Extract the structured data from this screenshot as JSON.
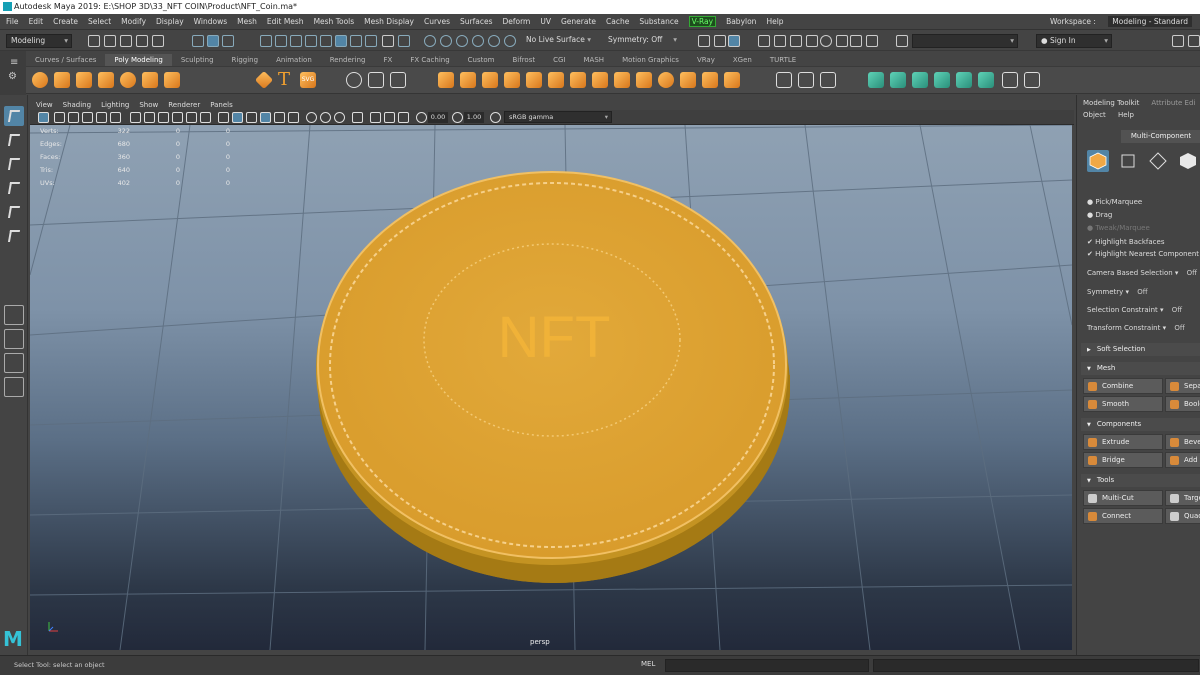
{
  "window": {
    "title": "Autodesk Maya 2019: E:\\SHOP 3D\\33_NFT COIN\\Product\\NFT_Coin.ma*"
  },
  "menubar": {
    "items": [
      "File",
      "Edit",
      "Create",
      "Select",
      "Modify",
      "Display",
      "Windows",
      "Mesh",
      "Edit Mesh",
      "Mesh Tools",
      "Mesh Display",
      "Curves",
      "Surfaces",
      "Deform",
      "UV",
      "Generate",
      "Cache",
      "Substance",
      "V-Ray",
      "Babylon",
      "Help"
    ],
    "workspace_label": "Workspace :",
    "workspace_value": "Modeling - Standard"
  },
  "statusline": {
    "mode": "Modeling",
    "live_surface": "No Live Surface",
    "symmetry": "Symmetry: Off",
    "sign_in": "Sign In"
  },
  "shelf": {
    "tabs": [
      "Curves / Surfaces",
      "Poly Modeling",
      "Sculpting",
      "Rigging",
      "Animation",
      "Rendering",
      "FX",
      "FX Caching",
      "Custom",
      "Bifrost",
      "CGI",
      "MASH",
      "Motion Graphics",
      "VRay",
      "XGen",
      "TURTLE"
    ],
    "active_tab": "Poly Modeling",
    "svg_label": "SVG",
    "text_icon": "T"
  },
  "panel": {
    "menu": [
      "View",
      "Shading",
      "Lighting",
      "Show",
      "Renderer",
      "Panels"
    ],
    "exposure": "0.00",
    "gamma": "1.00",
    "color_space": "sRGB gamma"
  },
  "hud": {
    "rows": [
      {
        "label": "Verts:",
        "values": [
          "322",
          "0",
          "0"
        ]
      },
      {
        "label": "Edges:",
        "values": [
          "680",
          "0",
          "0"
        ]
      },
      {
        "label": "Faces:",
        "values": [
          "360",
          "0",
          "0"
        ]
      },
      {
        "label": "Tris:",
        "values": [
          "640",
          "0",
          "0"
        ]
      },
      {
        "label": "UVs:",
        "values": [
          "402",
          "0",
          "0"
        ]
      }
    ]
  },
  "viewport": {
    "camera": "persp",
    "coin_text": "NFT",
    "coin_color": "#e2a93a"
  },
  "modeling_toolkit": {
    "tabs": [
      "Modeling Toolkit",
      "Attribute Edi"
    ],
    "menu": [
      "Object",
      "Help"
    ],
    "multi_component": "Multi-Component",
    "options": {
      "pick_marquee": "Pick/Marquee",
      "drag": "Drag",
      "tweak_marquee": "Tweak/Marquee",
      "highlight_backfaces": "Highlight Backfaces",
      "highlight_nearest": "Highlight Nearest Component",
      "camera_based": "Camera Based Selection",
      "camera_based_val": "Off",
      "symmetry": "Symmetry",
      "symmetry_val": "Off",
      "selection_constraint": "Selection Constraint",
      "selection_constraint_val": "Off",
      "transform_constraint": "Transform Constraint",
      "transform_constraint_val": "Off"
    },
    "sections": {
      "soft_selection": "Soft Selection",
      "mesh": "Mesh",
      "components": "Components",
      "tools": "Tools"
    },
    "buttons": {
      "combine": "Combine",
      "separate": "Separ",
      "smooth": "Smooth",
      "boolean": "Boole",
      "extrude": "Extrude",
      "bevel": "Bevel",
      "bridge": "Bridge",
      "add": "Add",
      "multi_cut": "Multi-Cut",
      "target": "Targe",
      "connect": "Connect",
      "quad": "Quad"
    }
  },
  "commandline": {
    "help": "Select Tool: select an object",
    "mel": "MEL"
  }
}
